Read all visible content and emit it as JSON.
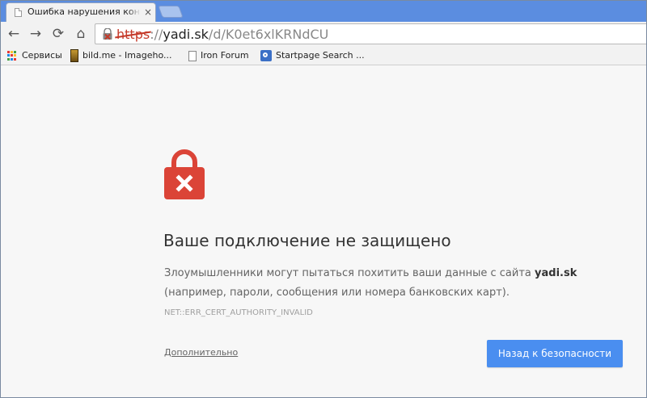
{
  "tab": {
    "title": "Ошибка нарушения кон",
    "close": "×"
  },
  "toolbar": {
    "back": "←",
    "forward": "→",
    "reload": "⟳",
    "home": "⌂"
  },
  "omnibox": {
    "scheme": "https",
    "separator": "://",
    "host": "yadi.sk",
    "path": "/d/K0et6xlKRNdCU"
  },
  "bookmarks": [
    {
      "label": "Сервисы",
      "icon": "apps-grid-icon"
    },
    {
      "label": "bild.me - Imageho...",
      "icon": "bild-icon"
    },
    {
      "label": "Iron Forum",
      "icon": "page-icon"
    },
    {
      "label": "Startpage Search ...",
      "icon": "startpage-icon"
    }
  ],
  "interstitial": {
    "heading": "Ваше подключение не защищено",
    "body_pre": "Злоумышленники могут пытаться похитить ваши данные с сайта ",
    "body_host": "yadi.sk",
    "body_post": " (например, пароли, сообщения или номера банковских карт). ",
    "error_code": "NET::ERR_CERT_AUTHORITY_INVALID",
    "details_link": "Дополнительно",
    "back_button": "Назад к безопасности"
  },
  "colors": {
    "tabstrip": "#5b8de0",
    "danger": "#db4437",
    "primary_button": "#4a8ef0"
  }
}
